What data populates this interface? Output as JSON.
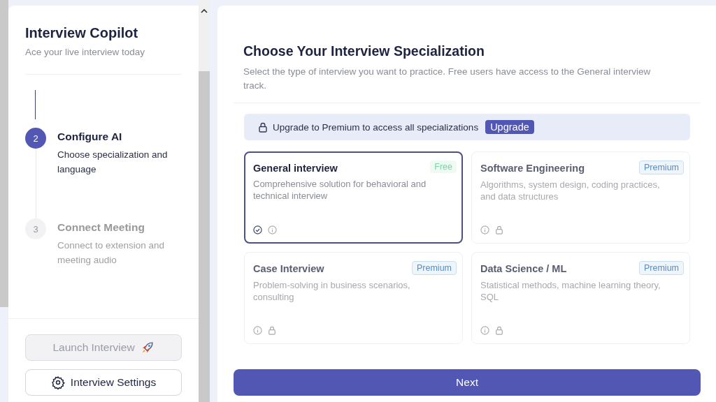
{
  "sidebar": {
    "title": "Interview Copilot",
    "subtitle": "Ace your live interview today",
    "steps": [
      {
        "number": "2",
        "title": "Configure AI",
        "description": "Choose specialization and language",
        "active": true
      },
      {
        "number": "3",
        "title": "Connect Meeting",
        "description": "Connect to extension and meeting audio",
        "active": false
      }
    ],
    "launch_button": {
      "label": "Launch Interview",
      "disabled": true
    },
    "settings_button": {
      "label": "Interview Settings"
    }
  },
  "main": {
    "title": "Choose Your Interview Specialization",
    "subtitle": "Select the type of interview you want to practice. Free users have access to the General interview track.",
    "banner": {
      "text": "Upgrade to Premium to access all specializations",
      "button": "Upgrade"
    },
    "cards": [
      {
        "title": "General interview",
        "description": "Comprehensive solution for behavioral and technical interview",
        "badge": "Free",
        "locked": false,
        "selected": true
      },
      {
        "title": "Software Engineering",
        "description": "Algorithms, system design, coding practices, and data structures",
        "badge": "Premium",
        "locked": true,
        "selected": false
      },
      {
        "title": "Case Interview",
        "description": "Problem-solving in business scenarios, consulting",
        "badge": "Premium",
        "locked": true,
        "selected": false
      },
      {
        "title": "Data Science / ML",
        "description": "Statistical methods, machine learning theory, SQL",
        "badge": "Premium",
        "locked": true,
        "selected": false
      }
    ],
    "next_button": "Next"
  }
}
